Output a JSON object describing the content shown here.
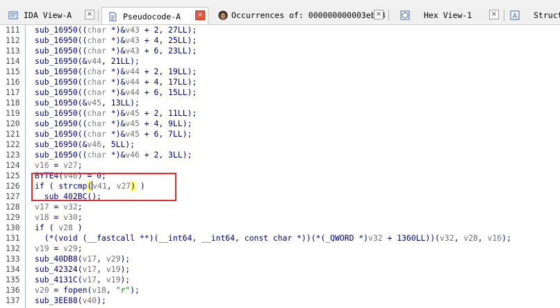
{
  "tabs": [
    {
      "label": "IDA View-A",
      "icon": "ida-view-icon",
      "active": false,
      "close": "×"
    },
    {
      "label": "Pseudocode-A",
      "icon": "pseudocode-icon",
      "active": true,
      "close": "×"
    },
    {
      "label": "Occurrences of: 000000000003ebe8",
      "icon": "occurrences-avatar-icon",
      "active": false,
      "close": "×"
    },
    {
      "label": "Hex View-1",
      "icon": "hex-view-icon",
      "active": false,
      "close": "×"
    },
    {
      "label": "Struct",
      "icon": "structures-icon",
      "active": false
    }
  ],
  "colors": {
    "code": "#000080",
    "variable": "#6f6f6f",
    "keyword": "#808080",
    "string": "#008000",
    "annotation_box": "#e82a2a",
    "match_highlight": "#ffff66"
  },
  "code_lines": [
    {
      "n": "111",
      "t": [
        [
          "p",
          "sub_16950(("
        ],
        [
          "k",
          "char"
        ],
        [
          "p",
          " *)&"
        ],
        [
          "v",
          "v43"
        ],
        [
          "p",
          " + 2, 27LL);"
        ]
      ]
    },
    {
      "n": "112",
      "t": [
        [
          "p",
          "sub_16950(("
        ],
        [
          "k",
          "char"
        ],
        [
          "p",
          " *)&"
        ],
        [
          "v",
          "v43"
        ],
        [
          "p",
          " + 4, 25LL);"
        ]
      ]
    },
    {
      "n": "113",
      "t": [
        [
          "p",
          "sub_16950(("
        ],
        [
          "k",
          "char"
        ],
        [
          "p",
          " *)&"
        ],
        [
          "v",
          "v43"
        ],
        [
          "p",
          " + 6, 23LL);"
        ]
      ]
    },
    {
      "n": "114",
      "t": [
        [
          "p",
          "sub_16950(&"
        ],
        [
          "v",
          "v44"
        ],
        [
          "p",
          ", 21LL);"
        ]
      ]
    },
    {
      "n": "115",
      "t": [
        [
          "p",
          "sub_16950(("
        ],
        [
          "k",
          "char"
        ],
        [
          "p",
          " *)&"
        ],
        [
          "v",
          "v44"
        ],
        [
          "p",
          " + 2, 19LL);"
        ]
      ]
    },
    {
      "n": "116",
      "t": [
        [
          "p",
          "sub_16950(("
        ],
        [
          "k",
          "char"
        ],
        [
          "p",
          " *)&"
        ],
        [
          "v",
          "v44"
        ],
        [
          "p",
          " + 4, 17LL);"
        ]
      ]
    },
    {
      "n": "117",
      "t": [
        [
          "p",
          "sub_16950(("
        ],
        [
          "k",
          "char"
        ],
        [
          "p",
          " *)&"
        ],
        [
          "v",
          "v44"
        ],
        [
          "p",
          " + 6, 15LL);"
        ]
      ]
    },
    {
      "n": "118",
      "t": [
        [
          "p",
          "sub_16950(&"
        ],
        [
          "v",
          "v45"
        ],
        [
          "p",
          ", 13LL);"
        ]
      ]
    },
    {
      "n": "119",
      "t": [
        [
          "p",
          "sub_16950(("
        ],
        [
          "k",
          "char"
        ],
        [
          "p",
          " *)&"
        ],
        [
          "v",
          "v45"
        ],
        [
          "p",
          " + 2, 11LL);"
        ]
      ]
    },
    {
      "n": "120",
      "t": [
        [
          "p",
          "sub_16950(("
        ],
        [
          "k",
          "char"
        ],
        [
          "p",
          " *)&"
        ],
        [
          "v",
          "v45"
        ],
        [
          "p",
          " + 4, 9LL);"
        ]
      ]
    },
    {
      "n": "121",
      "t": [
        [
          "p",
          "sub_16950(("
        ],
        [
          "k",
          "char"
        ],
        [
          "p",
          " *)&"
        ],
        [
          "v",
          "v45"
        ],
        [
          "p",
          " + 6, 7LL);"
        ]
      ]
    },
    {
      "n": "122",
      "t": [
        [
          "p",
          "sub_16950(&"
        ],
        [
          "v",
          "v46"
        ],
        [
          "p",
          ", 5LL);"
        ]
      ]
    },
    {
      "n": "123",
      "t": [
        [
          "p",
          "sub_16950(("
        ],
        [
          "k",
          "char"
        ],
        [
          "p",
          " *)&"
        ],
        [
          "v",
          "v46"
        ],
        [
          "p",
          " + 2, 3LL);"
        ]
      ]
    },
    {
      "n": "124",
      "t": [
        [
          "v",
          "v16"
        ],
        [
          "p",
          " = "
        ],
        [
          "v",
          "v27"
        ],
        [
          "p",
          ";"
        ]
      ]
    },
    {
      "n": "125",
      "t": [
        [
          "p",
          "BYTE4("
        ],
        [
          "v",
          "v46"
        ],
        [
          "p",
          ") = 0;"
        ]
      ]
    },
    {
      "n": "126",
      "t": [
        [
          "p",
          "if ( strcmp"
        ],
        [
          "h",
          "("
        ],
        [
          "c",
          ""
        ],
        [
          "v",
          "v41"
        ],
        [
          "p",
          ", "
        ],
        [
          "v",
          "v27"
        ],
        [
          "h",
          ")"
        ],
        [
          "p",
          " )"
        ]
      ]
    },
    {
      "n": "127",
      "t": [
        [
          "p",
          "  sub_402BC();"
        ]
      ]
    },
    {
      "n": "128",
      "t": [
        [
          "v",
          "v17"
        ],
        [
          "p",
          " = "
        ],
        [
          "v",
          "v32"
        ],
        [
          "p",
          ";"
        ]
      ]
    },
    {
      "n": "129",
      "t": [
        [
          "v",
          "v18"
        ],
        [
          "p",
          " = "
        ],
        [
          "v",
          "v30"
        ],
        [
          "p",
          ";"
        ]
      ]
    },
    {
      "n": "130",
      "t": [
        [
          "p",
          "if ( "
        ],
        [
          "v",
          "v28"
        ],
        [
          "p",
          " )"
        ]
      ]
    },
    {
      "n": "131",
      "t": [
        [
          "p",
          "  (*(void (__fastcall **)(__int64, __int64, const char *))(*(_QWORD *)"
        ],
        [
          "v",
          "v32"
        ],
        [
          "p",
          " + 1360LL))("
        ],
        [
          "v",
          "v32"
        ],
        [
          "p",
          ", "
        ],
        [
          "v",
          "v28"
        ],
        [
          "p",
          ", "
        ],
        [
          "v",
          "v16"
        ],
        [
          "p",
          ");"
        ]
      ]
    },
    {
      "n": "132",
      "t": [
        [
          "v",
          "v19"
        ],
        [
          "p",
          " = "
        ],
        [
          "v",
          "v29"
        ],
        [
          "p",
          ";"
        ]
      ]
    },
    {
      "n": "133",
      "t": [
        [
          "p",
          "sub_40DB8("
        ],
        [
          "v",
          "v17"
        ],
        [
          "p",
          ", "
        ],
        [
          "v",
          "v29"
        ],
        [
          "p",
          ");"
        ]
      ]
    },
    {
      "n": "134",
      "t": [
        [
          "p",
          "sub_42324("
        ],
        [
          "v",
          "v17"
        ],
        [
          "p",
          ", "
        ],
        [
          "v",
          "v19"
        ],
        [
          "p",
          ");"
        ]
      ]
    },
    {
      "n": "135",
      "t": [
        [
          "p",
          "sub_4131C("
        ],
        [
          "v",
          "v17"
        ],
        [
          "p",
          ", "
        ],
        [
          "v",
          "v19"
        ],
        [
          "p",
          ");"
        ]
      ]
    },
    {
      "n": "136",
      "t": [
        [
          "v",
          "v20"
        ],
        [
          "p",
          " = fopen("
        ],
        [
          "v",
          "v18"
        ],
        [
          "p",
          ", "
        ],
        [
          "s",
          "\"r\""
        ],
        [
          "p",
          ");"
        ]
      ]
    },
    {
      "n": "137",
      "t": [
        [
          "p",
          "sub_3EE88("
        ],
        [
          "v",
          "v40"
        ],
        [
          "p",
          ");"
        ]
      ]
    }
  ]
}
